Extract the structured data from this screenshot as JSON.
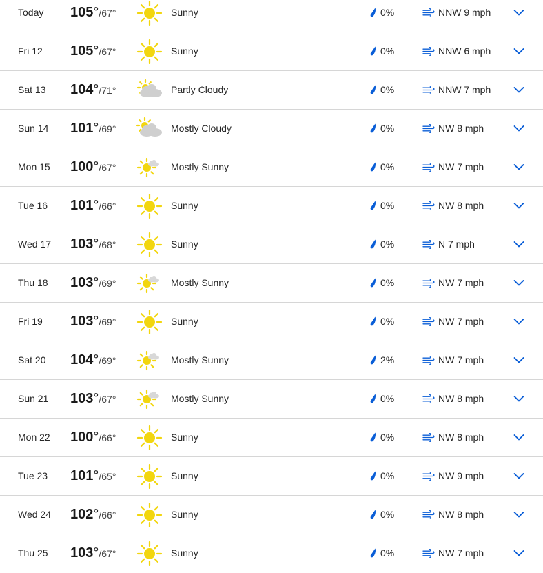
{
  "colors": {
    "accent": "#0a5ed7",
    "sun": "#f2d60f",
    "cloud": "#cfcfcf",
    "divider": "#d6d6d6"
  },
  "forecast": [
    {
      "day": "Today",
      "hi": "105",
      "lo": "67",
      "icon": "sunny-icon",
      "condition": "Sunny",
      "precip": "0%",
      "wind": "NNW 9 mph"
    },
    {
      "day": "Fri 12",
      "hi": "105",
      "lo": "67",
      "icon": "sunny-icon",
      "condition": "Sunny",
      "precip": "0%",
      "wind": "NNW 6 mph"
    },
    {
      "day": "Sat 13",
      "hi": "104",
      "lo": "71",
      "icon": "partly-cloudy-icon",
      "condition": "Partly Cloudy",
      "precip": "0%",
      "wind": "NNW 7 mph"
    },
    {
      "day": "Sun 14",
      "hi": "101",
      "lo": "69",
      "icon": "mostly-cloudy-icon",
      "condition": "Mostly Cloudy",
      "precip": "0%",
      "wind": "NW 8 mph"
    },
    {
      "day": "Mon 15",
      "hi": "100",
      "lo": "67",
      "icon": "mostly-sunny-icon",
      "condition": "Mostly Sunny",
      "precip": "0%",
      "wind": "NW 7 mph"
    },
    {
      "day": "Tue 16",
      "hi": "101",
      "lo": "66",
      "icon": "sunny-icon",
      "condition": "Sunny",
      "precip": "0%",
      "wind": "NW 8 mph"
    },
    {
      "day": "Wed 17",
      "hi": "103",
      "lo": "68",
      "icon": "sunny-icon",
      "condition": "Sunny",
      "precip": "0%",
      "wind": "N 7 mph"
    },
    {
      "day": "Thu 18",
      "hi": "103",
      "lo": "69",
      "icon": "mostly-sunny-icon",
      "condition": "Mostly Sunny",
      "precip": "0%",
      "wind": "NW 7 mph"
    },
    {
      "day": "Fri 19",
      "hi": "103",
      "lo": "69",
      "icon": "sunny-icon",
      "condition": "Sunny",
      "precip": "0%",
      "wind": "NW 7 mph"
    },
    {
      "day": "Sat 20",
      "hi": "104",
      "lo": "69",
      "icon": "mostly-sunny-icon",
      "condition": "Mostly Sunny",
      "precip": "2%",
      "wind": "NW 7 mph"
    },
    {
      "day": "Sun 21",
      "hi": "103",
      "lo": "67",
      "icon": "mostly-sunny-icon",
      "condition": "Mostly Sunny",
      "precip": "0%",
      "wind": "NW 8 mph"
    },
    {
      "day": "Mon 22",
      "hi": "100",
      "lo": "66",
      "icon": "sunny-icon",
      "condition": "Sunny",
      "precip": "0%",
      "wind": "NW 8 mph"
    },
    {
      "day": "Tue 23",
      "hi": "101",
      "lo": "65",
      "icon": "sunny-icon",
      "condition": "Sunny",
      "precip": "0%",
      "wind": "NW 9 mph"
    },
    {
      "day": "Wed 24",
      "hi": "102",
      "lo": "66",
      "icon": "sunny-icon",
      "condition": "Sunny",
      "precip": "0%",
      "wind": "NW 8 mph"
    },
    {
      "day": "Thu 25",
      "hi": "103",
      "lo": "67",
      "icon": "sunny-icon",
      "condition": "Sunny",
      "precip": "0%",
      "wind": "NW 7 mph"
    }
  ]
}
